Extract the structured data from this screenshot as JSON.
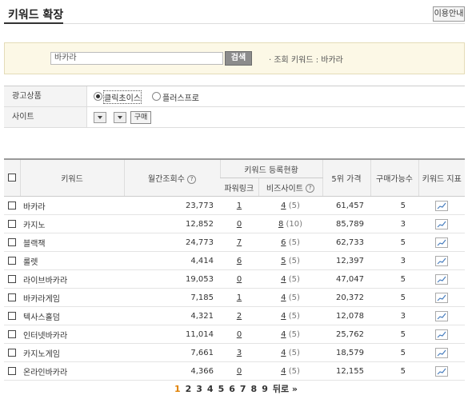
{
  "header": {
    "title": "키워드 확장",
    "help_label": "이용안내"
  },
  "search": {
    "value": "바카라",
    "button_label": "검색",
    "query_info": "· 조회 키워드 : 바카라"
  },
  "options": {
    "ad_product_label": "광고상품",
    "radio_1": "클릭초이스",
    "radio_2": "플러스프로",
    "site_label": "사이트",
    "buy_label": "구매"
  },
  "table": {
    "headers": {
      "keyword": "키워드",
      "monthly": "월간조회수",
      "reg_status": "키워드 등록현황",
      "power_link": "파워링크",
      "biz_site": "비즈사이트",
      "price5": "5위 가격",
      "buyable": "구매가능수",
      "indicator": "키워드 지표",
      "q": "?"
    },
    "rows": [
      {
        "keyword": "바카라",
        "monthly": "23,773",
        "pl": "1",
        "bs": "4",
        "bs_sub": "(5)",
        "price": "61,457",
        "buy": "5"
      },
      {
        "keyword": "카지노",
        "monthly": "12,852",
        "pl": "0",
        "bs": "8",
        "bs_sub": "(10)",
        "price": "85,789",
        "buy": "3"
      },
      {
        "keyword": "블랙잭",
        "monthly": "24,773",
        "pl": "7",
        "bs": "6",
        "bs_sub": "(5)",
        "price": "62,733",
        "buy": "5"
      },
      {
        "keyword": "룰렛",
        "monthly": "4,414",
        "pl": "6",
        "bs": "5",
        "bs_sub": "(5)",
        "price": "12,397",
        "buy": "3"
      },
      {
        "keyword": "라이브바카라",
        "monthly": "19,053",
        "pl": "0",
        "bs": "4",
        "bs_sub": "(5)",
        "price": "47,047",
        "buy": "5"
      },
      {
        "keyword": "바카라게임",
        "monthly": "7,185",
        "pl": "1",
        "bs": "4",
        "bs_sub": "(5)",
        "price": "20,372",
        "buy": "5"
      },
      {
        "keyword": "텍사스홀덤",
        "monthly": "4,321",
        "pl": "2",
        "bs": "4",
        "bs_sub": "(5)",
        "price": "12,078",
        "buy": "3"
      },
      {
        "keyword": "인터넷바카라",
        "monthly": "11,014",
        "pl": "0",
        "bs": "4",
        "bs_sub": "(5)",
        "price": "25,762",
        "buy": "5"
      },
      {
        "keyword": "카지노게임",
        "monthly": "7,661",
        "pl": "3",
        "bs": "4",
        "bs_sub": "(5)",
        "price": "18,579",
        "buy": "5"
      },
      {
        "keyword": "온라인바카라",
        "monthly": "4,366",
        "pl": "0",
        "bs": "4",
        "bs_sub": "(5)",
        "price": "12,155",
        "buy": "5"
      }
    ]
  },
  "pagination": {
    "pages": [
      "1",
      "2",
      "3",
      "4",
      "5",
      "6",
      "7",
      "8",
      "9"
    ],
    "current": "1",
    "next_label": "뒤로 »"
  },
  "colors": {
    "accent": "#e08000",
    "search_bg": "#fcf8e6"
  }
}
